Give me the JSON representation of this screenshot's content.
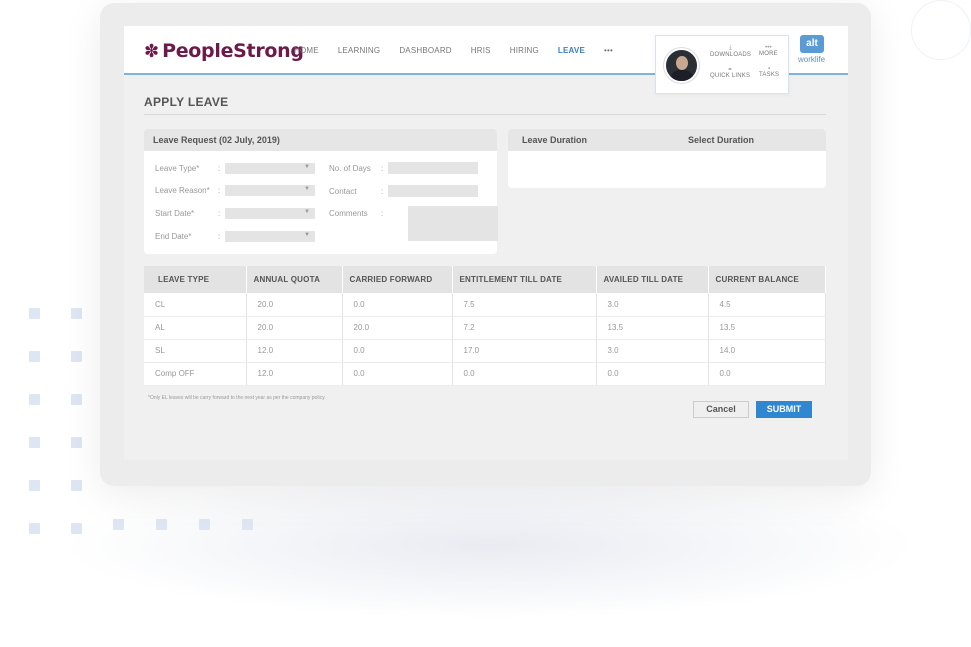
{
  "header": {
    "logo_mark": "✽",
    "logo_text": "PeopleStrong",
    "nav": [
      {
        "label": "HOME"
      },
      {
        "label": "LEARNING"
      },
      {
        "label": "DASHBOARD"
      },
      {
        "label": "HRIS"
      },
      {
        "label": "HIRING"
      },
      {
        "label": "LEAVE"
      },
      {
        "label": "•••"
      }
    ],
    "quick": {
      "downloads": "DOWNLOADS",
      "more": "MORE",
      "quick_links": "QUICK LINKS",
      "tasks": "TASKS"
    },
    "alt_badge": "alt",
    "alt_sub": "worklife"
  },
  "page": {
    "title": "APPLY LEAVE"
  },
  "leave_request": {
    "heading": "Leave Request (02 July, 2019)",
    "fields": {
      "leave_type": "Leave Type*",
      "leave_reason": "Leave Reason*",
      "start_date": "Start Date*",
      "end_date": "End Date*",
      "no_of_days": "No. of Days",
      "contact": "Contact",
      "comments": "Comments"
    }
  },
  "duration": {
    "heading_left": "Leave Duration",
    "heading_right": "Select Duration"
  },
  "table": {
    "headers": [
      "LEAVE TYPE",
      "ANNUAL QUOTA",
      "CARRIED FORWARD",
      "ENTITLEMENT TILL DATE",
      "AVAILED TILL DATE",
      "CURRENT BALANCE"
    ],
    "rows": [
      [
        "CL",
        "20.0",
        "0.0",
        "7.5",
        "3.0",
        "4.5"
      ],
      [
        "AL",
        "20.0",
        "20.0",
        "7.2",
        "13.5",
        "13.5"
      ],
      [
        "SL",
        "12.0",
        "0.0",
        "17.0",
        "3.0",
        "14.0"
      ],
      [
        "Comp OFF",
        "12.0",
        "0.0",
        "0.0",
        "0.0",
        "0.0"
      ]
    ]
  },
  "footer": {
    "note": "*Only EL leaves will be carry forward to the next year as per the company policy.",
    "cancel": "Cancel",
    "submit": "SUBMIT"
  },
  "colors": {
    "brand": "#6b1a4a",
    "accent": "#2f86d1",
    "nav_active": "#3a7fc4"
  }
}
